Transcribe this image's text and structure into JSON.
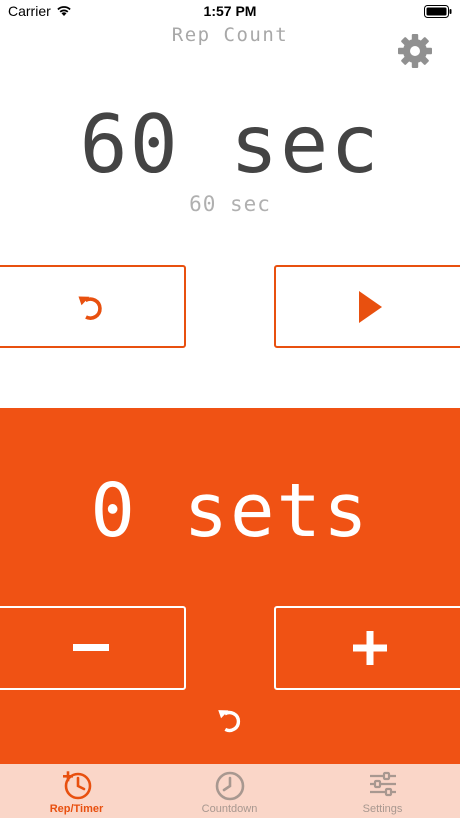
{
  "status_bar": {
    "carrier": "Carrier",
    "time": "1:57 PM"
  },
  "header": {
    "title": "Rep Count",
    "settings_icon": "gear-icon"
  },
  "timer": {
    "display": "60 sec",
    "subtitle": "60 sec"
  },
  "controls": {
    "reset_icon": "undo-icon",
    "start_icon": "play-icon"
  },
  "counter": {
    "display": "0 sets",
    "decrement_label": "−",
    "increment_label": "+",
    "reset_icon": "undo-icon"
  },
  "tabs": [
    {
      "label": "Rep/Timer",
      "icon": "rep-timer-icon",
      "active": true
    },
    {
      "label": "Countdown",
      "icon": "countdown-icon",
      "active": false
    },
    {
      "label": "Settings",
      "icon": "sliders-icon",
      "active": false
    }
  ],
  "colors": {
    "accent": "#f05214",
    "tab_bar_bg": "#fad6c8",
    "inactive_tab": "#a89890",
    "timer_text": "#444444"
  }
}
